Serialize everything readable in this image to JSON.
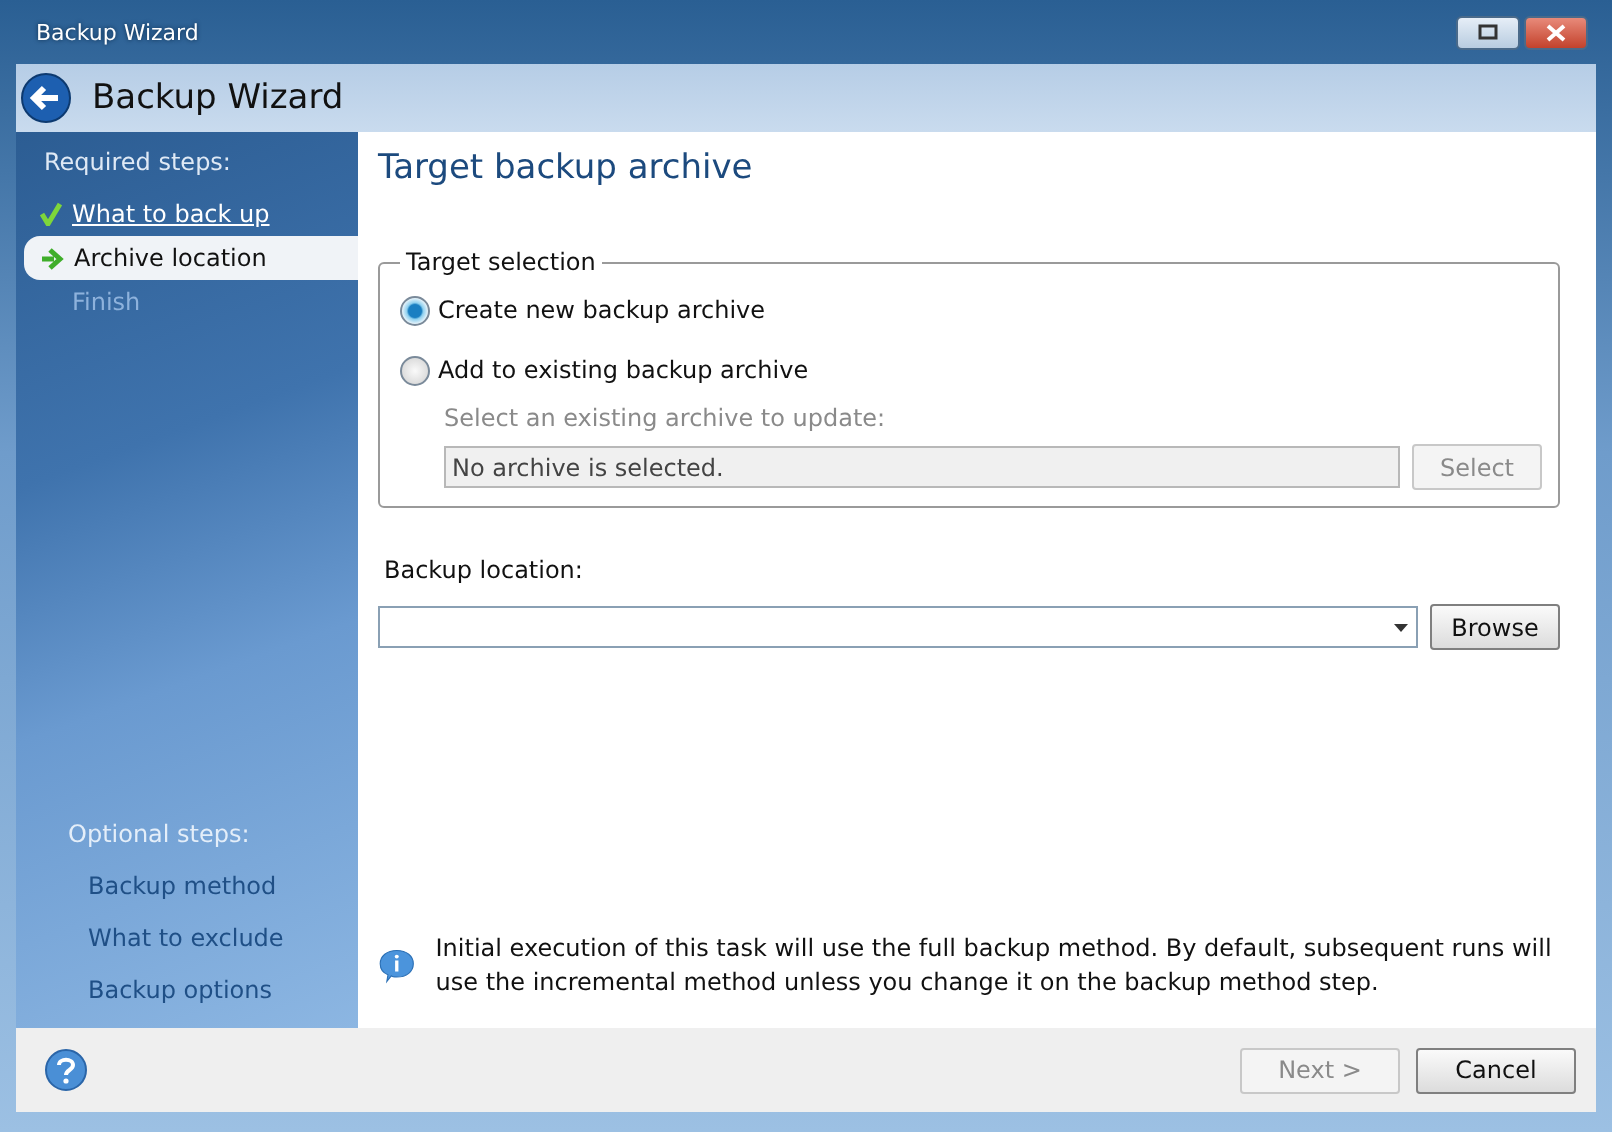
{
  "window": {
    "title": "Backup Wizard"
  },
  "header": {
    "title": "Backup Wizard"
  },
  "sidebar": {
    "required_heading": "Required steps:",
    "required_steps": [
      {
        "label": "What to back up",
        "kind": "done",
        "selected": false
      },
      {
        "label": "Archive location",
        "kind": "current",
        "selected": true
      },
      {
        "label": "Finish",
        "kind": "pending",
        "selected": false
      }
    ],
    "optional_heading": "Optional steps:",
    "optional_steps": [
      {
        "label": "Backup method"
      },
      {
        "label": "What to exclude"
      },
      {
        "label": "Backup options"
      }
    ]
  },
  "page": {
    "title": "Target backup archive",
    "target_selection": {
      "legend": "Target selection",
      "options": [
        {
          "label": "Create new backup archive",
          "selected": true
        },
        {
          "label": "Add to existing backup archive",
          "selected": false
        }
      ],
      "existing_label": "Select an existing archive to update:",
      "existing_field": {
        "value": "No archive is selected.",
        "disabled": true
      },
      "select_button": {
        "label": "Select",
        "disabled": true
      }
    },
    "location_label": "Backup location:",
    "browse_button": "Browse",
    "info": "Initial execution of this task will use the full backup method. By default, subsequent runs will use the incremental method unless you change it on the backup method step."
  },
  "footer": {
    "next": {
      "label": "Next >",
      "disabled": true
    },
    "cancel": {
      "label": "Cancel",
      "disabled": false
    }
  }
}
